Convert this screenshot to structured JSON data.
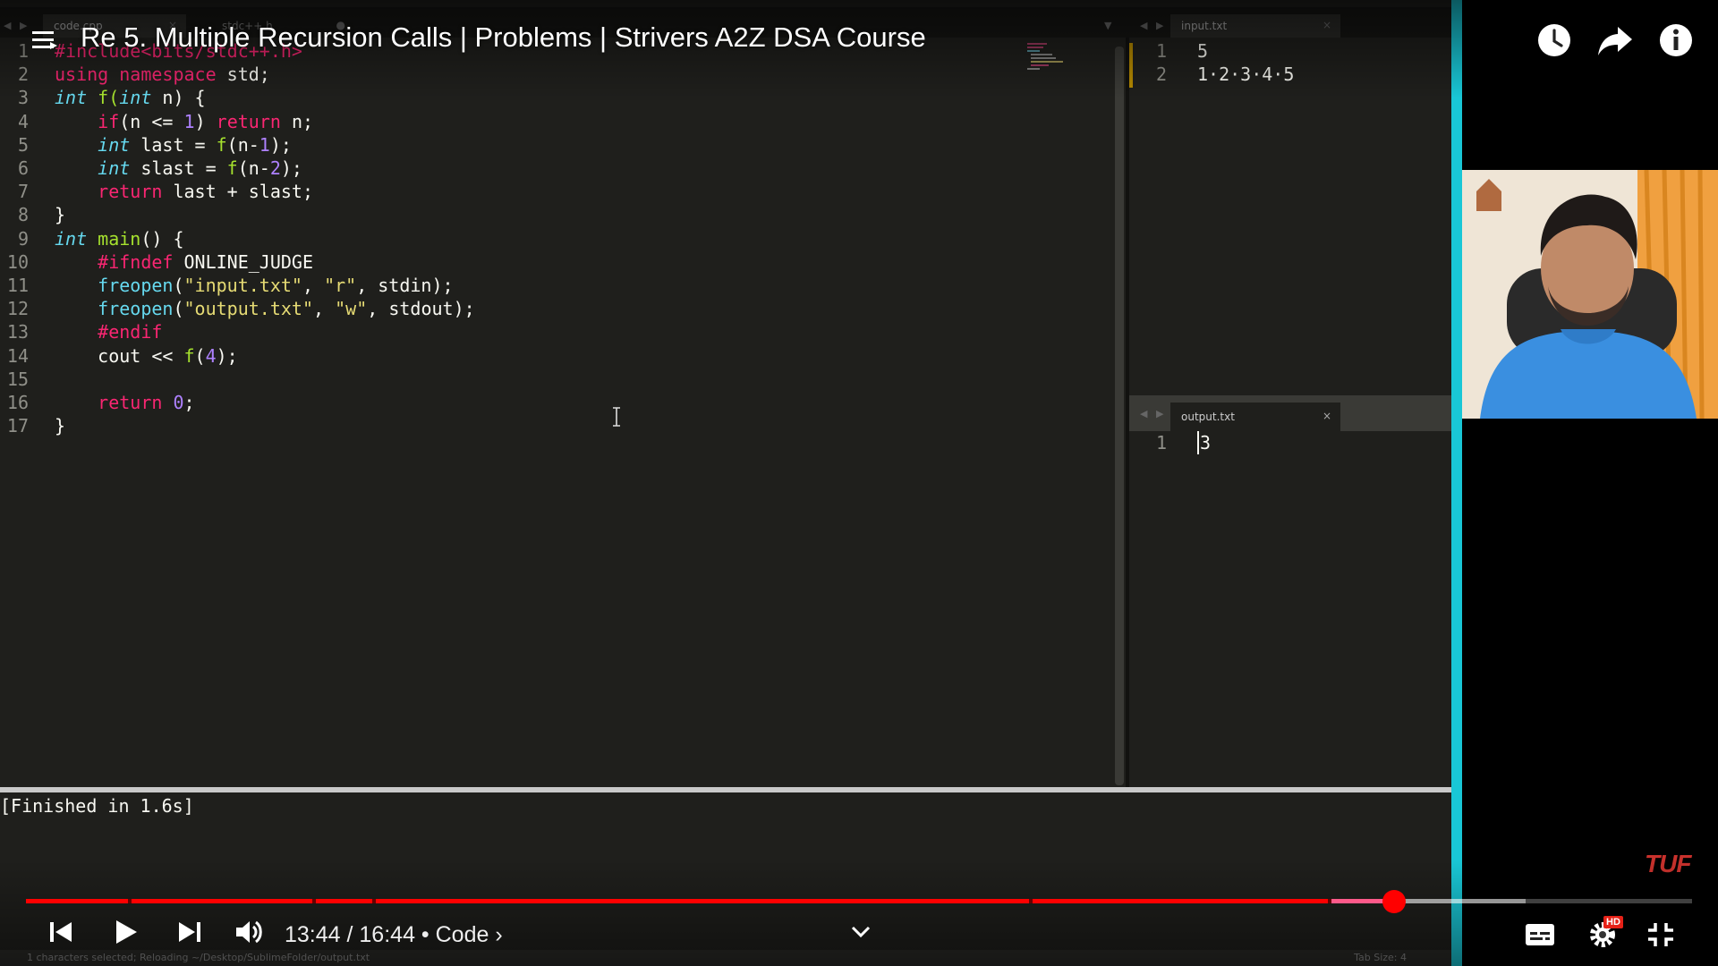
{
  "video": {
    "title": "Re 5. Multiple Recursion Calls | Problems | Strivers A2Z DSA Course",
    "time_current": "13:44",
    "time_separator": " / ",
    "time_total": "16:44",
    "chapter_separator": " • ",
    "chapter": "Code",
    "chapter_chevron": "›",
    "progress_played_fraction": 0.8213,
    "progress_buffered_fraction": 0.9
  },
  "editor": {
    "left_tabs": [
      {
        "label": "code.cpp",
        "close": "×"
      },
      {
        "label": "stdc++.h",
        "close": "●"
      }
    ],
    "right_tab": {
      "label": "input.txt",
      "close": "×"
    },
    "output_tab": {
      "label": "output.txt",
      "close": "×"
    },
    "nav_arrows": "◀ ▶",
    "code_lines": [
      {
        "n": "1"
      },
      {
        "n": "2"
      },
      {
        "n": "3"
      },
      {
        "n": "4"
      },
      {
        "n": "5"
      },
      {
        "n": "6"
      },
      {
        "n": "7"
      },
      {
        "n": "8"
      },
      {
        "n": "9"
      },
      {
        "n": "10"
      },
      {
        "n": "11"
      },
      {
        "n": "12"
      },
      {
        "n": "13"
      },
      {
        "n": "14"
      },
      {
        "n": "15"
      },
      {
        "n": "16"
      },
      {
        "n": "17"
      }
    ],
    "tokens": {
      "l1": "#include<bits/stdc++.h>",
      "l2a": "using",
      "l2b": "namespace",
      "l2c": " std;",
      "l3a": "int",
      "l3b": " f(",
      "l3c": "int",
      "l3d": " n) {",
      "l4a": "    ",
      "l4b": "if",
      "l4c": "(n <= ",
      "l4d": "1",
      "l4e": ") ",
      "l4f": "return",
      "l4g": " n;",
      "l5a": "    ",
      "l5b": "int",
      "l5c": " last = ",
      "l5d": "f",
      "l5e": "(n-",
      "l5f": "1",
      "l5g": ");",
      "l6a": "    ",
      "l6b": "int",
      "l6c": " slast = ",
      "l6d": "f",
      "l6e": "(n-",
      "l6f": "2",
      "l6g": ");",
      "l7a": "    ",
      "l7b": "return",
      "l7c": " last + slast;",
      "l8": "}",
      "l9a": "int",
      "l9b": " ",
      "l9c": "main",
      "l9d": "() {",
      "l10a": "    ",
      "l10b": "#ifndef",
      "l10c": " ONLINE_JUDGE",
      "l11a": "    ",
      "l11b": "freopen",
      "l11c": "(",
      "l11d": "\"input.txt\"",
      "l11e": ", ",
      "l11f": "\"r\"",
      "l11g": ", stdin);",
      "l12a": "    ",
      "l12b": "freopen",
      "l12c": "(",
      "l12d": "\"output.txt\"",
      "l12e": ", ",
      "l12f": "\"w\"",
      "l12g": ", stdout);",
      "l13a": "    ",
      "l13b": "#endif",
      "l14a": "    cout << ",
      "l14b": "f",
      "l14c": "(",
      "l14d": "4",
      "l14e": ");",
      "l15": "",
      "l16a": "    ",
      "l16b": "return",
      "l16c": " ",
      "l16d": "0",
      "l16e": ";",
      "l17": "}"
    },
    "input_lines": [
      {
        "n": "1",
        "text": "5"
      },
      {
        "n": "2",
        "text": "1·2·3·4·5"
      }
    ],
    "output_lines": [
      {
        "n": "1",
        "text": "3"
      }
    ],
    "console_text": "[Finished in 1.6s]",
    "status_text": "1 characters selected; Reloading ~/Desktop/SublimeFolder/output.txt",
    "tab_size": "Tab Size: 4"
  },
  "branding": {
    "logo_text": "TUF"
  },
  "icons": {
    "menu": "hamburger-icon",
    "watch_later": "clock-icon",
    "share": "share-arrow-icon",
    "info": "info-icon",
    "prev": "skip-previous-icon",
    "play": "play-icon",
    "next": "skip-next-icon",
    "volume": "volume-icon",
    "chapters": "chevron-down-icon",
    "subtitles": "subtitles-icon",
    "settings": "settings-gear-icon",
    "hd_badge": "HD",
    "fullscreen_exit": "exit-fullscreen-icon"
  },
  "colors": {
    "editor_bg": "#1f1f1c",
    "keyword": "#f92672",
    "type": "#66d9ef",
    "function": "#a6e22e",
    "number": "#ae81ff",
    "string": "#e6db74",
    "accent_bar": "#19c7d6",
    "progress_red": "#ff0000"
  }
}
